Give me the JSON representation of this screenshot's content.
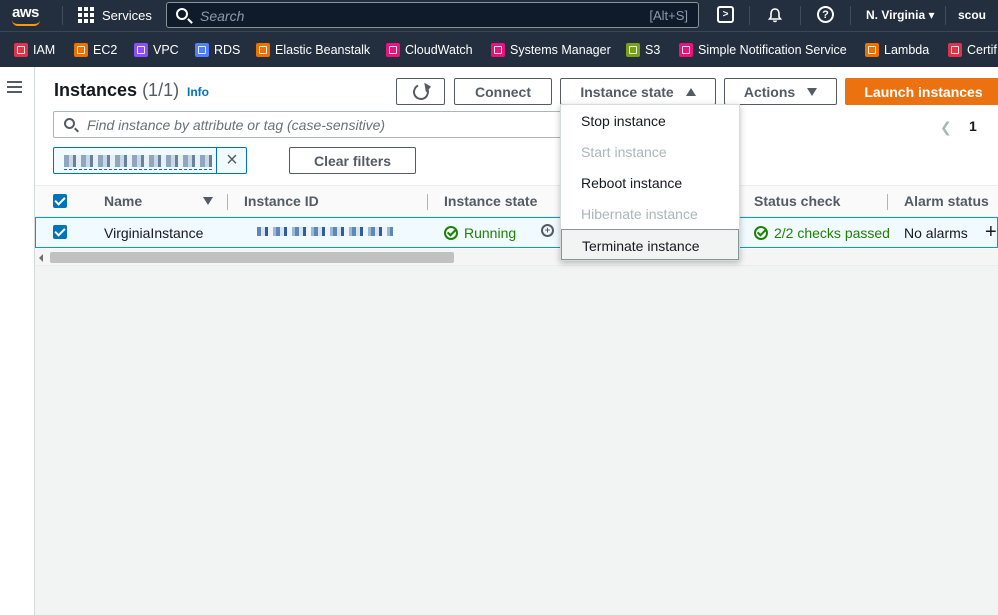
{
  "topbar": {
    "logo": "aws",
    "services_label": "Services",
    "search_placeholder": "Search",
    "search_shortcut": "[Alt+S]",
    "region": "N. Virginia ▾",
    "account": "scou"
  },
  "favorites": [
    {
      "label": "IAM",
      "color": "#dd344c"
    },
    {
      "label": "EC2",
      "color": "#ed7100"
    },
    {
      "label": "VPC",
      "color": "#8c4fff"
    },
    {
      "label": "RDS",
      "color": "#527fff"
    },
    {
      "label": "Elastic Beanstalk",
      "color": "#ed7100"
    },
    {
      "label": "CloudWatch",
      "color": "#e7157b"
    },
    {
      "label": "Systems Manager",
      "color": "#e7157b"
    },
    {
      "label": "S3",
      "color": "#7aa116"
    },
    {
      "label": "Simple Notification Service",
      "color": "#e7157b"
    },
    {
      "label": "Lambda",
      "color": "#ed7100"
    },
    {
      "label": "Certif",
      "color": "#dd344c"
    }
  ],
  "page": {
    "title": "Instances",
    "count": "(1/1)",
    "info": "Info"
  },
  "toolbar": {
    "connect": "Connect",
    "instance_state": "Instance state",
    "actions": "Actions",
    "launch": "Launch instances"
  },
  "filter": {
    "placeholder": "Find instance by attribute or tag (case-sensitive)",
    "clear": "Clear filters"
  },
  "pagination": {
    "current": "1"
  },
  "table": {
    "columns": [
      "Name",
      "Instance ID",
      "Instance state",
      "Status check",
      "Alarm status"
    ],
    "rows": [
      {
        "name": "VirginiaInstance",
        "state": "Running",
        "status_check": "2/2 checks passed",
        "alarm": "No alarms",
        "alarm_add": "+"
      }
    ]
  },
  "instance_state_menu": [
    {
      "label": "Stop instance",
      "enabled": true
    },
    {
      "label": "Start instance",
      "enabled": false
    },
    {
      "label": "Reboot instance",
      "enabled": true
    },
    {
      "label": "Hibernate instance",
      "enabled": false
    },
    {
      "label": "Terminate instance",
      "enabled": true
    }
  ],
  "colors": {
    "nav_bg": "#232f3e",
    "primary_button": "#ec7211",
    "link": "#0073bb",
    "success": "#1d8102"
  }
}
